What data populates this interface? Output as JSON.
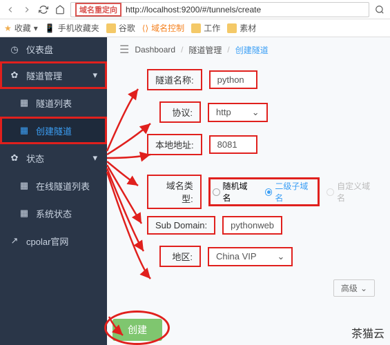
{
  "browser": {
    "url_prefix": "域名重定向",
    "url": "http://localhost:9200/#/tunnels/create"
  },
  "bookmarks": {
    "fav": "收藏",
    "mobile": "手机收藏夹",
    "google": "谷歌",
    "domain_control": "域名控制",
    "work": "工作",
    "material": "素材"
  },
  "sidebar": {
    "dashboard": "仪表盘",
    "tunnel_mgmt": "隧道管理",
    "tunnel_list": "隧道列表",
    "create_tunnel": "创建隧道",
    "status": "状态",
    "online_tunnel_list": "在线隧道列表",
    "system_status": "系统状态",
    "cpolar_site": "cpolar官网"
  },
  "breadcrumb": {
    "dashboard": "Dashboard",
    "tunnel_mgmt": "隧道管理",
    "create_tunnel": "创建隧道"
  },
  "form": {
    "name_label": "隧道名称:",
    "name_value": "python",
    "protocol_label": "协议:",
    "protocol_value": "http",
    "local_addr_label": "本地地址:",
    "local_addr_value": "8081",
    "domain_type_label": "域名类型:",
    "domain_type_random": "随机域名",
    "domain_type_secondary": "二级子域名",
    "domain_type_custom": "自定义域名",
    "subdomain_label": "Sub Domain:",
    "subdomain_value": "pythonweb",
    "region_label": "地区:",
    "region_value": "China VIP",
    "advanced": "高级",
    "submit": "创建"
  },
  "watermark": "茶猫云"
}
